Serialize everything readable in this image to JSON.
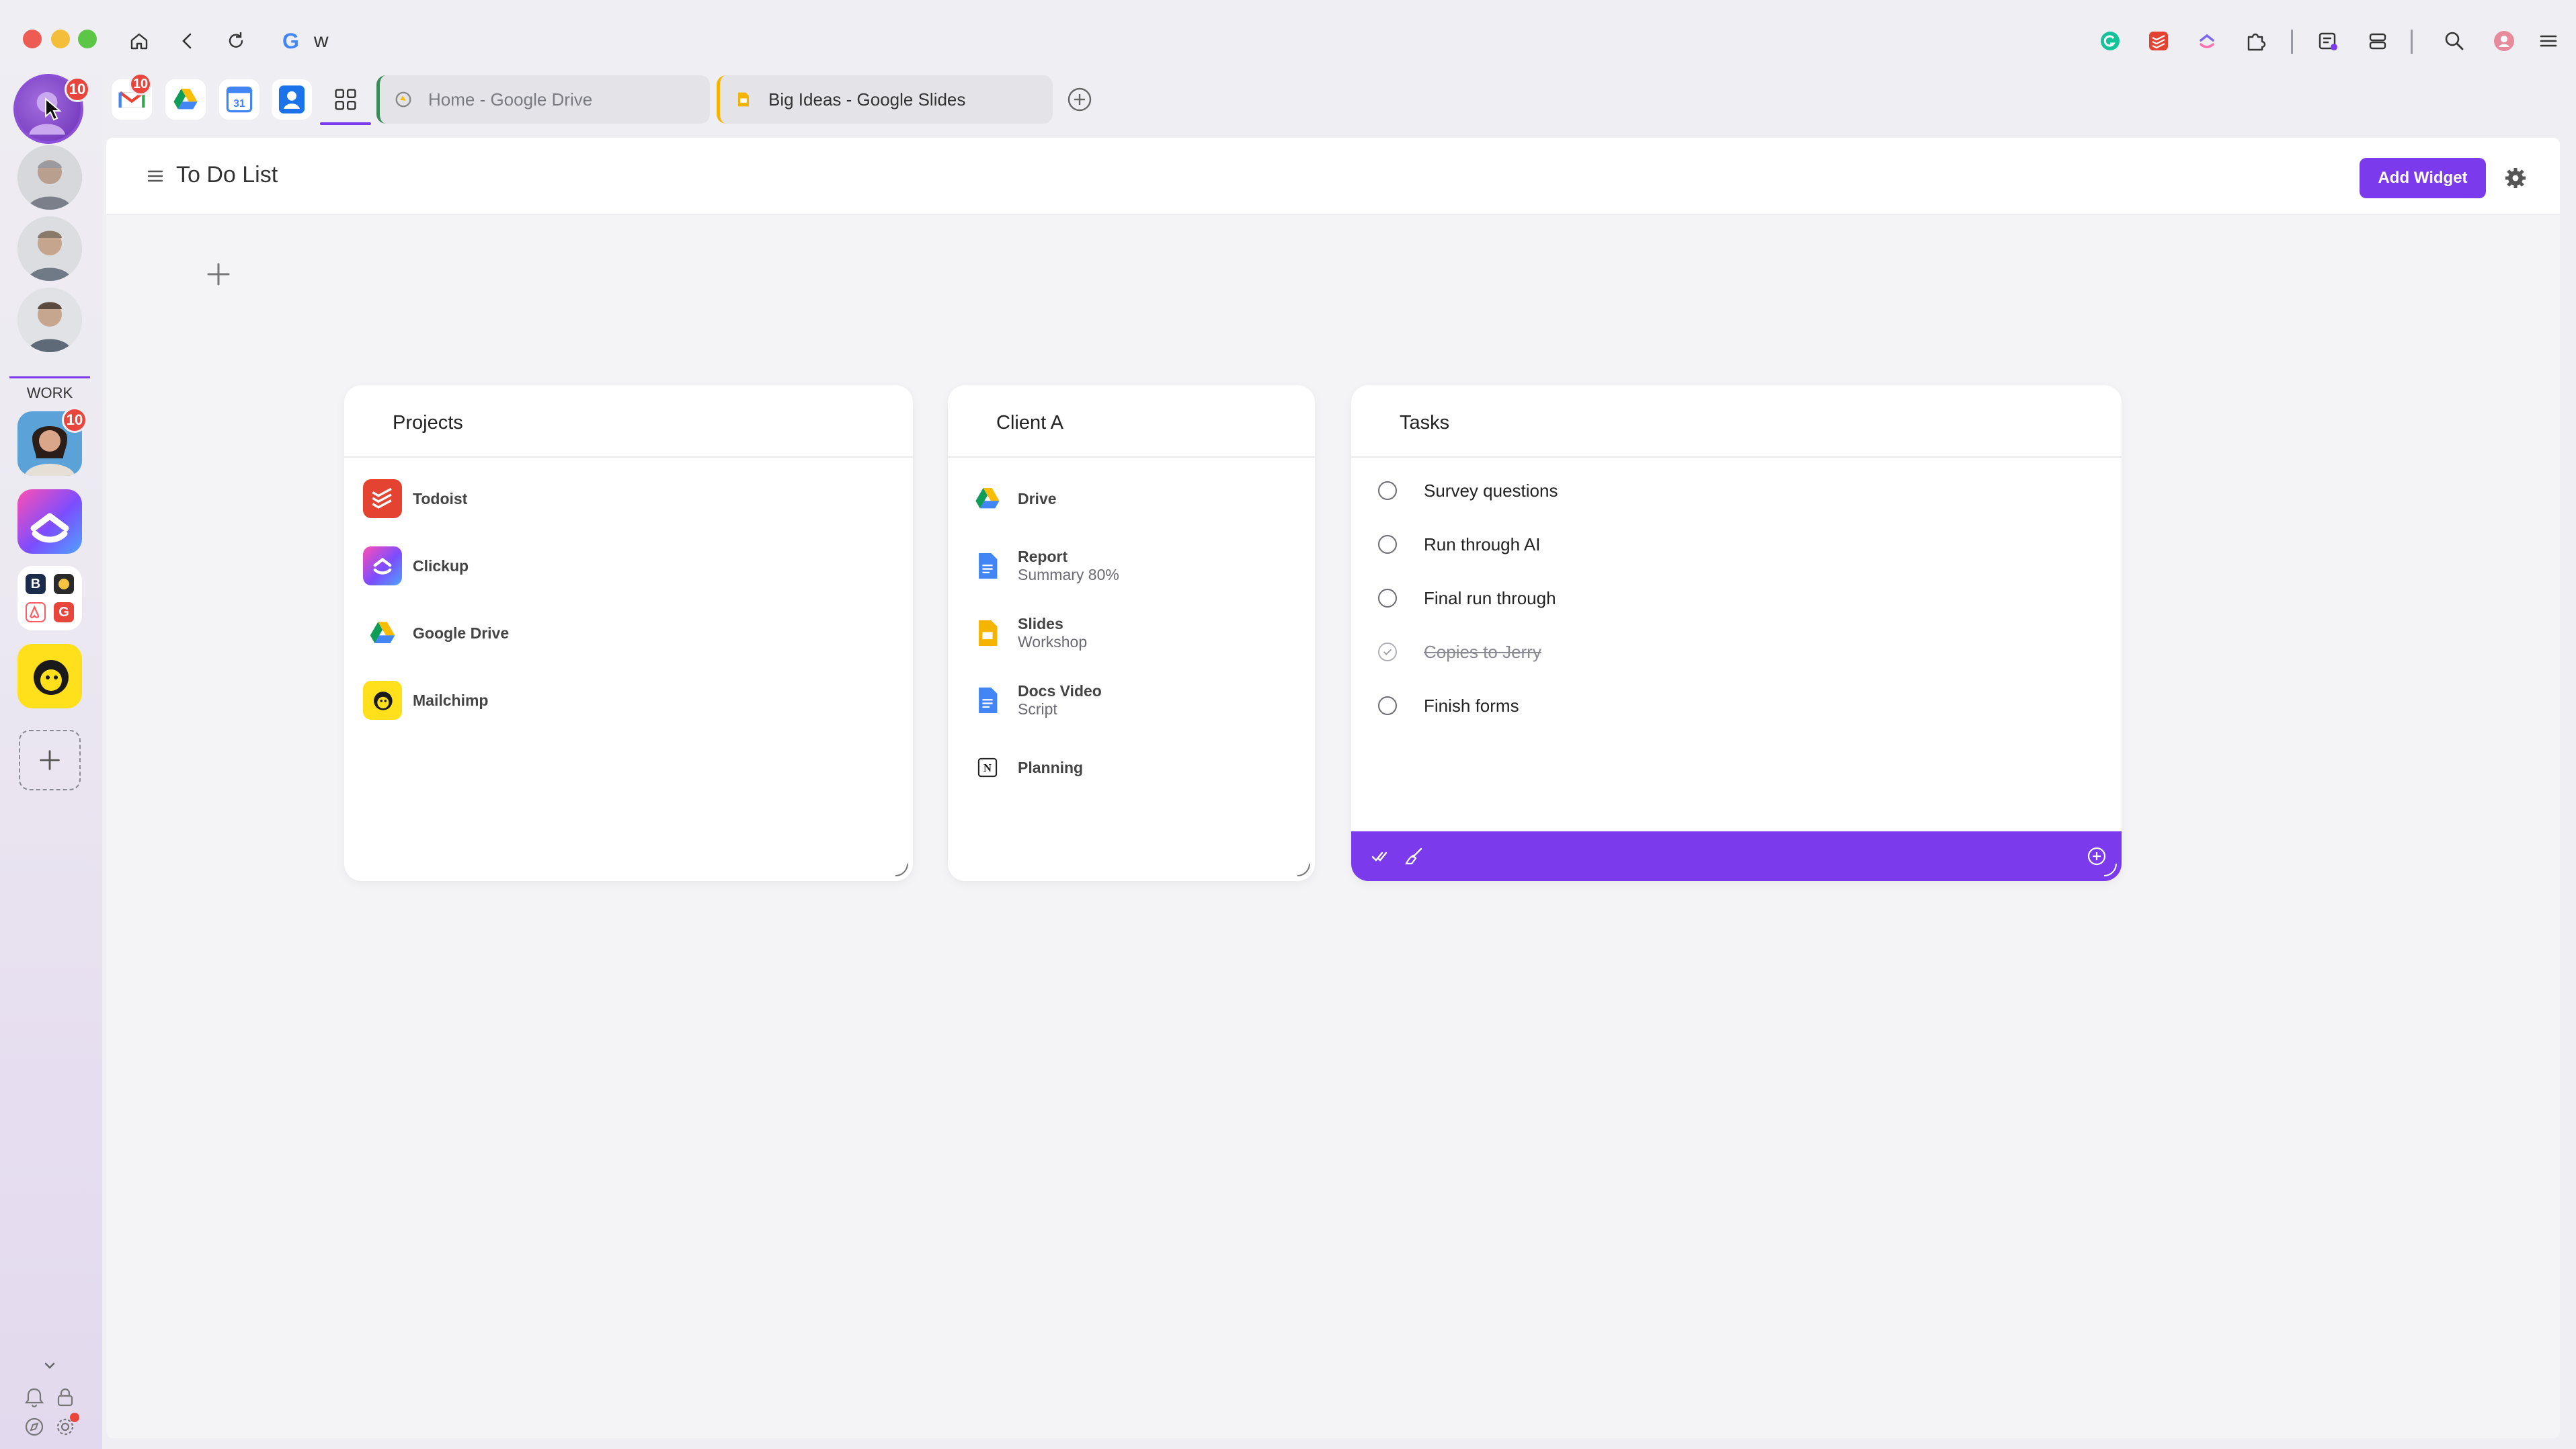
{
  "browser": {
    "address_text": "w",
    "tabs": [
      {
        "label": "Home - Google Drive",
        "icon": "google-drive-favicon"
      },
      {
        "label": "Big Ideas - Google Slides",
        "icon": "google-slides-favicon"
      }
    ],
    "pinned_apps": [
      {
        "name": "gmail-icon",
        "badge": "10"
      },
      {
        "name": "google-drive-icon"
      },
      {
        "name": "google-calendar-icon"
      },
      {
        "name": "contacts-icon"
      },
      {
        "name": "apps-grid-icon"
      }
    ]
  },
  "sidebar": {
    "profile_badge": "10",
    "section_label": "WORK",
    "work_badge": "10"
  },
  "page": {
    "title": "To Do List",
    "add_widget_label": "Add Widget"
  },
  "projects": {
    "title": "Projects",
    "items": [
      {
        "label": "Todoist",
        "icon": "todoist-icon"
      },
      {
        "label": "Clickup",
        "icon": "clickup-icon"
      },
      {
        "label": "Google Drive",
        "icon": "google-drive-icon"
      },
      {
        "label": "Mailchimp",
        "icon": "mailchimp-icon"
      }
    ]
  },
  "client": {
    "title": "Client A",
    "items": [
      {
        "label": "Drive",
        "sub": "",
        "icon": "google-drive-icon"
      },
      {
        "label": "Report",
        "sub": "Summary 80%",
        "icon": "google-docs-icon"
      },
      {
        "label": "Slides",
        "sub": "Workshop",
        "icon": "google-slides-icon"
      },
      {
        "label": "Docs Video",
        "sub": "Script",
        "icon": "google-docs-icon"
      },
      {
        "label": "Planning",
        "sub": "",
        "icon": "notion-icon"
      }
    ]
  },
  "tasks": {
    "title": "Tasks",
    "items": [
      {
        "label": "Survey questions",
        "done": false
      },
      {
        "label": "Run through AI",
        "done": false
      },
      {
        "label": "Final run through",
        "done": false
      },
      {
        "label": "Copies to Jerry",
        "done": true
      },
      {
        "label": "Finish forms",
        "done": false
      }
    ]
  },
  "colors": {
    "accent": "#7c3aed",
    "badge": "#e8453c"
  }
}
